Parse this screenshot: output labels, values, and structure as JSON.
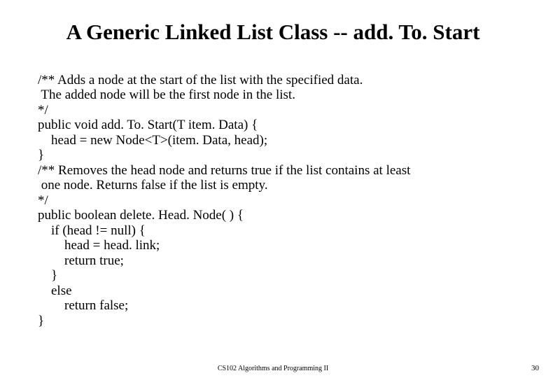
{
  "title": "A Generic Linked List Class -- add. To. Start",
  "code": {
    "l1": "/** Adds a node at the start of the list with the specified data.",
    "l2": " The added node will be the first node in the list.",
    "l3": "*/",
    "l4": "public void add. To. Start(T item. Data) {",
    "l5": "    head = new Node<T>(item. Data, head);",
    "l6": "}",
    "l7": "/** Removes the head node and returns true if the list contains at least",
    "l8": " one node. Returns false if the list is empty.",
    "l9": "*/",
    "l10": "public boolean delete. Head. Node( ) {",
    "l11": "    if (head != null) {",
    "l12": "        head = head. link;",
    "l13": "        return true;",
    "l14": "    }",
    "l15": "    else",
    "l16": "        return false;",
    "l17": "}"
  },
  "footer": "CS102 Algorithms and Programming II",
  "page": "30"
}
